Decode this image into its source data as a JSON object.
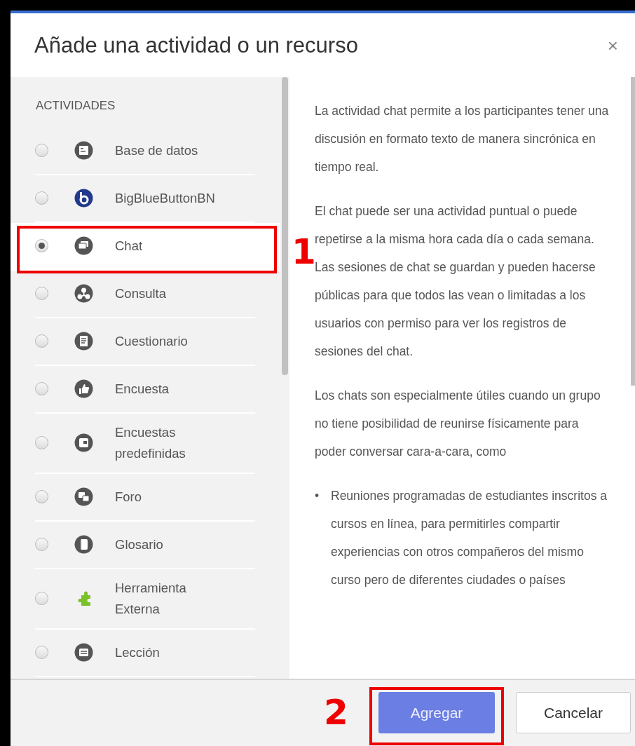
{
  "dialog": {
    "title": "Añade una actividad o un recurso",
    "close": "×"
  },
  "list": {
    "heading": "ACTIVIDADES",
    "items": [
      {
        "label": "Base de datos",
        "selected": false
      },
      {
        "label": "BigBlueButtonBN",
        "selected": false
      },
      {
        "label": "Chat",
        "selected": true
      },
      {
        "label": "Consulta",
        "selected": false
      },
      {
        "label": "Cuestionario",
        "selected": false
      },
      {
        "label": "Encuesta",
        "selected": false
      },
      {
        "label": "Encuestas predefinidas",
        "selected": false
      },
      {
        "label": "Foro",
        "selected": false
      },
      {
        "label": "Glosario",
        "selected": false
      },
      {
        "label": "Herramienta Externa",
        "selected": false
      },
      {
        "label": "Lección",
        "selected": false
      }
    ]
  },
  "description": {
    "paragraphs": [
      "La actividad chat permite a los participantes tener una discusión en formato texto de manera sincrónica en tiempo real.",
      "El chat puede ser una actividad puntual o puede repetirse a la misma hora cada día o cada semana. Las sesiones de chat se guardan y pueden hacerse públicas para que todos las vean o limitadas a los usuarios con permiso para ver los registros de sesiones del chat.",
      "Los chats son especialmente útiles cuando un grupo no tiene posibilidad de reunirse físicamente para poder conversar cara-a-cara, como"
    ],
    "bullets": [
      {
        "marker": "•",
        "text": "Reuniones programadas de estudiantes inscritos a cursos en línea, para permitirles compartir experiencias con otros compañeros del mismo curso pero de diferentes ciudades o países"
      }
    ]
  },
  "buttons": [
    {
      "label": "Agregar",
      "kind": "primary"
    },
    {
      "label": "Cancelar",
      "kind": "secondary"
    }
  ],
  "annotations": [
    {
      "label": "1"
    },
    {
      "label": "2"
    }
  ]
}
